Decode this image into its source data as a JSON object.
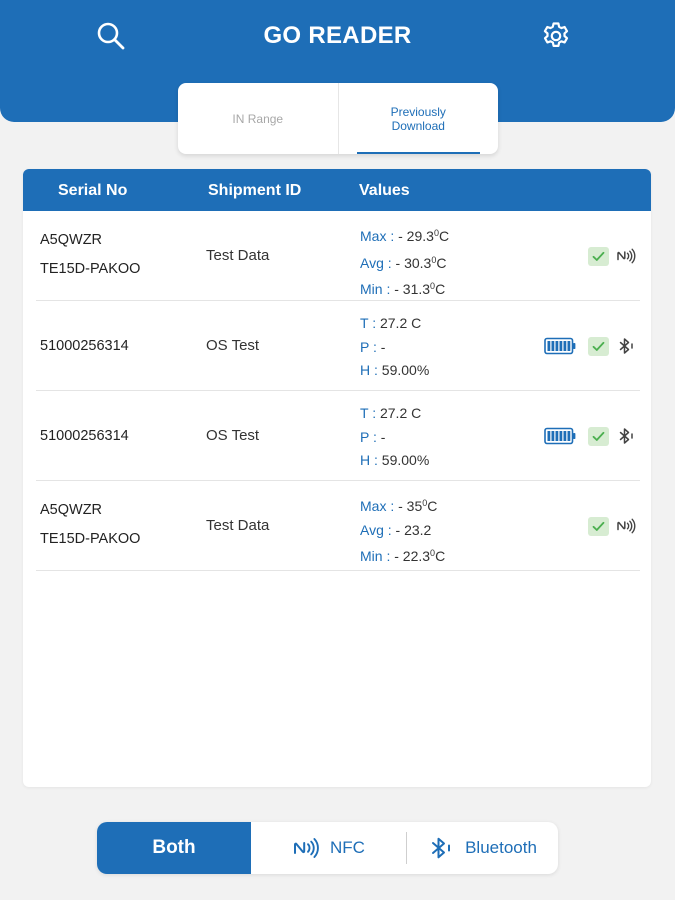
{
  "header": {
    "title": "GO READER"
  },
  "tabs": [
    {
      "label": "IN Range",
      "active": false
    },
    {
      "label": "Previously Download",
      "active": true
    }
  ],
  "table": {
    "columns": [
      "Serial No",
      "Shipment ID",
      "Values"
    ],
    "rows": [
      {
        "serial": [
          "A5QWZR",
          "TE15D-PAKOO"
        ],
        "shipment": "Test Data",
        "values": [
          {
            "key": "Max",
            "sep": " : ",
            "val": "- 29.3",
            "sup": "0",
            "unit": "C"
          },
          {
            "key": "Avg",
            "sep": " : ",
            "val": "- 30.3",
            "sup": "0",
            "unit": "C"
          },
          {
            "key": "Min",
            "sep": " : ",
            "val": "- 31.3",
            "sup": "0",
            "unit": "C"
          }
        ],
        "battery": false,
        "status": "check-icon",
        "connection": "nfc-icon"
      },
      {
        "serial": [
          "51000256314"
        ],
        "shipment": "OS Test",
        "values": [
          {
            "key": "T",
            "sep": " : ",
            "val": "27.2 C",
            "sup": "",
            "unit": ""
          },
          {
            "key": "P",
            "sep": " : ",
            "val": "-",
            "sup": "",
            "unit": ""
          },
          {
            "key": "H",
            "sep": " : ",
            "val": "59.00%",
            "sup": "",
            "unit": ""
          }
        ],
        "battery": true,
        "status": "check-icon",
        "connection": "bluetooth-icon"
      },
      {
        "serial": [
          "51000256314"
        ],
        "shipment": "OS Test",
        "values": [
          {
            "key": "T",
            "sep": " : ",
            "val": "27.2 C",
            "sup": "",
            "unit": ""
          },
          {
            "key": "P",
            "sep": " : ",
            "val": "-",
            "sup": "",
            "unit": ""
          },
          {
            "key": "H",
            "sep": " : ",
            "val": "59.00%",
            "sup": "",
            "unit": ""
          }
        ],
        "battery": true,
        "status": "check-icon",
        "connection": "bluetooth-icon"
      },
      {
        "serial": [
          "A5QWZR",
          "TE15D-PAKOO"
        ],
        "shipment": "Test Data",
        "values": [
          {
            "key": "Max",
            "sep": " : ",
            "val": "- 35",
            "sup": "0",
            "unit": "C"
          },
          {
            "key": "Avg",
            "sep": " : ",
            "val": "- 23.2",
            "sup": "",
            "unit": ""
          },
          {
            "key": "Min",
            "sep": " : ",
            "val": "- 22.3",
            "sup": "0",
            "unit": "C"
          }
        ],
        "battery": false,
        "status": "check-icon",
        "connection": "nfc-icon"
      }
    ]
  },
  "filter": {
    "both_label": "Both",
    "nfc_label": "NFC",
    "bluetooth_label": "Bluetooth",
    "selected": "Both"
  },
  "colors": {
    "primary": "#1e6eb7",
    "check_bg": "#d7ecd2",
    "check_mark": "#4caf50",
    "background": "#f2f2f2"
  }
}
